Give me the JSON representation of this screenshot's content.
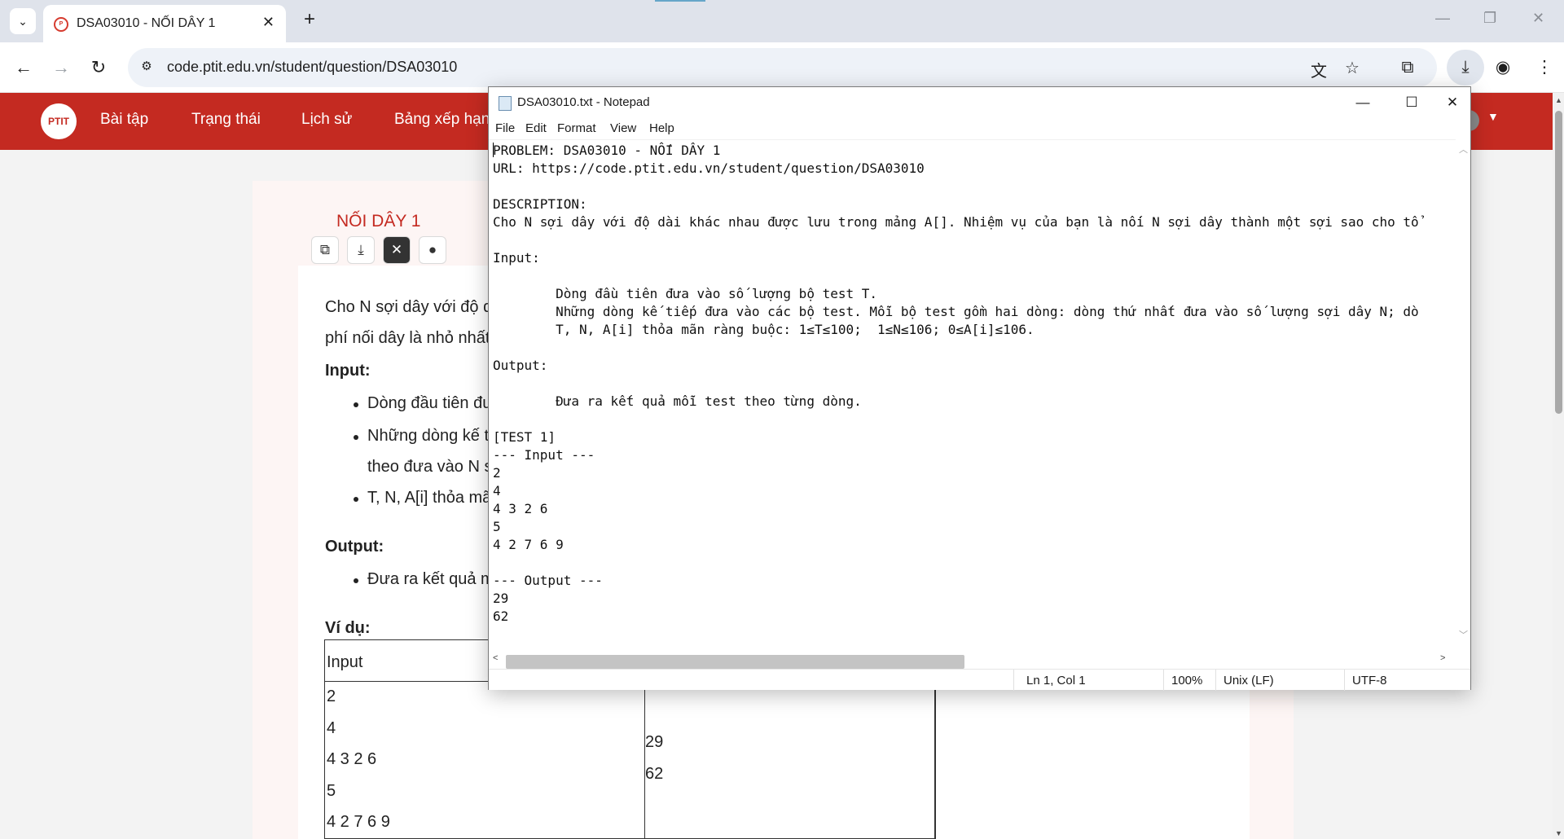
{
  "browser": {
    "tab_title": "DSA03010 - NỐI DÂY 1",
    "url": "code.ptit.edu.vn/student/question/DSA03010",
    "tab_list_icon": "chevron-down-icon",
    "new_tab_glyph": "+",
    "tab_close_glyph": "✕",
    "icons": {
      "back": "←",
      "forward": "→",
      "reload": "↻",
      "site_info": "⚙",
      "translate": "文",
      "star": "☆",
      "extensions": "⧉",
      "download": "⤓",
      "profile": "◉",
      "menu": "⋮",
      "minimize": "—",
      "restore": "❐",
      "close": "✕"
    }
  },
  "site": {
    "logo_text": "PTIT",
    "nav": [
      "Bài tập",
      "Trạng thái",
      "Lịch sử",
      "Bảng xếp hạng"
    ],
    "accent_color": "#c42a21"
  },
  "problem": {
    "title": "NỐI DÂY 1",
    "description_line1": "Cho N sợi dây với độ dà",
    "description_line2": "phí nối dây là nhỏ nhất.",
    "input_heading": "Input:",
    "input_items": [
      "Dòng đầu tiên đư",
      "Những dòng kế ti",
      "T, N, A[i] thỏa mã"
    ],
    "input_item2_cont": "theo đưa vào N s",
    "output_heading": "Output:",
    "output_items": [
      "Đưa ra kết quả m"
    ],
    "example_heading": "Ví dụ:",
    "example_header": "Input",
    "example_input": [
      "2",
      "4",
      "4 3 2 6",
      "5",
      "4 2 7 6 9"
    ],
    "example_output": [
      "29",
      "62"
    ]
  },
  "notepad": {
    "title": "DSA03010.txt - Notepad",
    "menu": [
      "File",
      "Edit",
      "Format",
      "View",
      "Help"
    ],
    "content": "PROBLEM: DSA03010 - NỐI DÂY 1\nURL: https://code.ptit.edu.vn/student/question/DSA03010\n\nDESCRIPTION:\nCho N sợi dây với độ dài khác nhau được lưu trong mảng A[]. Nhiệm vụ của bạn là nối N sợi dây thành một sợi sao cho tổ\n\nInput:\n\n        Dòng đầu tiên đưa vào số lượng bộ test T.\n        Những dòng kế tiếp đưa vào các bộ test. Mỗi bộ test gồm hai dòng: dòng thứ nhất đưa vào số lượng sợi dây N; dò\n        T, N, A[i] thỏa mãn ràng buộc: 1≤T≤100;  1≤N≤106; 0≤A[i]≤106.\n\nOutput:\n\n        Đưa ra kết quả mỗi test theo từng dòng.\n\n[TEST 1]\n--- Input ---\n2\n4\n4 3 2 6\n5\n4 2 7 6 9\n\n--- Output ---\n29\n62",
    "status": {
      "position": "Ln 1, Col 1",
      "zoom": "100%",
      "line_ending": "Unix (LF)",
      "encoding": "UTF-8"
    },
    "controls": {
      "minimize": "—",
      "maximize": "☐",
      "close": "✕"
    }
  }
}
